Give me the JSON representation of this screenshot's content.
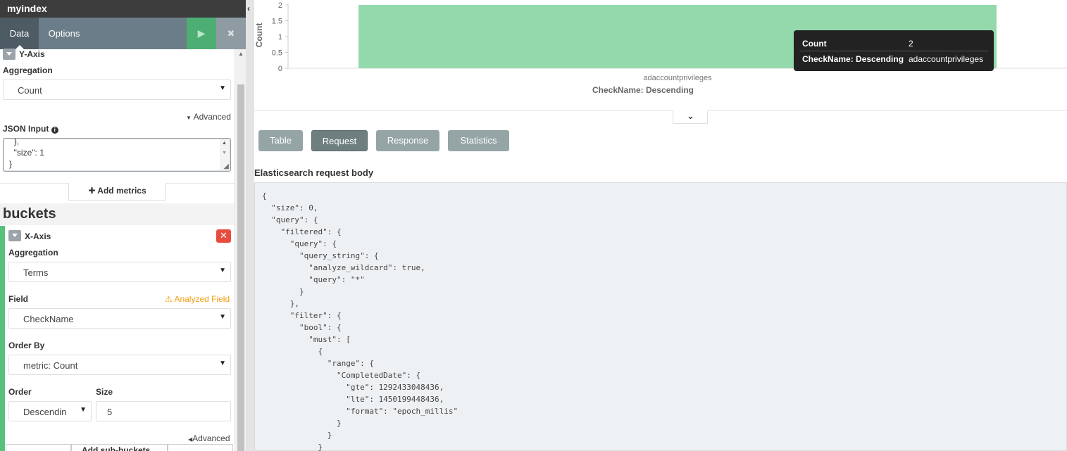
{
  "app": {
    "title": "myindex"
  },
  "tabs": {
    "data": "Data",
    "options": "Options"
  },
  "toolbar": {
    "apply_icon": "play-icon",
    "discard_icon": "close-icon",
    "apply_glyph": "▶",
    "discard_glyph": "✖"
  },
  "metrics": {
    "section": "Y-Axis",
    "aggregation_label": "Aggregation",
    "aggregation_value": "Count",
    "advanced_label": "Advanced",
    "json_label": "JSON Input",
    "json_value": "  },\n  \"size\": 1\n}",
    "add_label": "Add metrics"
  },
  "buckets": {
    "title": "buckets",
    "section": "X-Axis",
    "aggregation_label": "Aggregation",
    "aggregation_value": "Terms",
    "field_label": "Field",
    "field_warning": "Analyzed Field",
    "field_value": "CheckName",
    "order_by_label": "Order By",
    "order_by_value": "metric: Count",
    "order_label": "Order",
    "order_value": "Descendin",
    "size_label": "Size",
    "size_value": "5",
    "advanced_label": "Advanced",
    "add_sub_label": "Add sub-buckets"
  },
  "chart_data": {
    "type": "bar",
    "categories": [
      "adaccountprivileges"
    ],
    "values": [
      2
    ],
    "title": "",
    "xlabel": "CheckName: Descending",
    "ylabel": "Count",
    "ylim": [
      0,
      2
    ],
    "yticks": [
      "0",
      "0.5",
      "1",
      "1.5",
      "2"
    ],
    "bar_color": "#94d9ab",
    "grid": false,
    "tooltip": {
      "count_key": "Count",
      "count_value": "2",
      "name_key": "CheckName: Descending",
      "name_value": "adaccountprivileges"
    }
  },
  "view_tabs": [
    "Table",
    "Request",
    "Response",
    "Statistics"
  ],
  "request": {
    "title": "Elasticsearch request body",
    "body": "{\n  \"size\": 0,\n  \"query\": {\n    \"filtered\": {\n      \"query\": {\n        \"query_string\": {\n          \"analyze_wildcard\": true,\n          \"query\": \"*\"\n        }\n      },\n      \"filter\": {\n        \"bool\": {\n          \"must\": [\n            {\n              \"range\": {\n                \"CompletedDate\": {\n                  \"gte\": 1292433048436,\n                  \"lte\": 1450199448436,\n                  \"format\": \"epoch_millis\"\n                }\n              }\n            }"
  },
  "colors": {
    "accent": "#57c17b",
    "danger": "#e74c3c",
    "warning": "#f39c12"
  }
}
